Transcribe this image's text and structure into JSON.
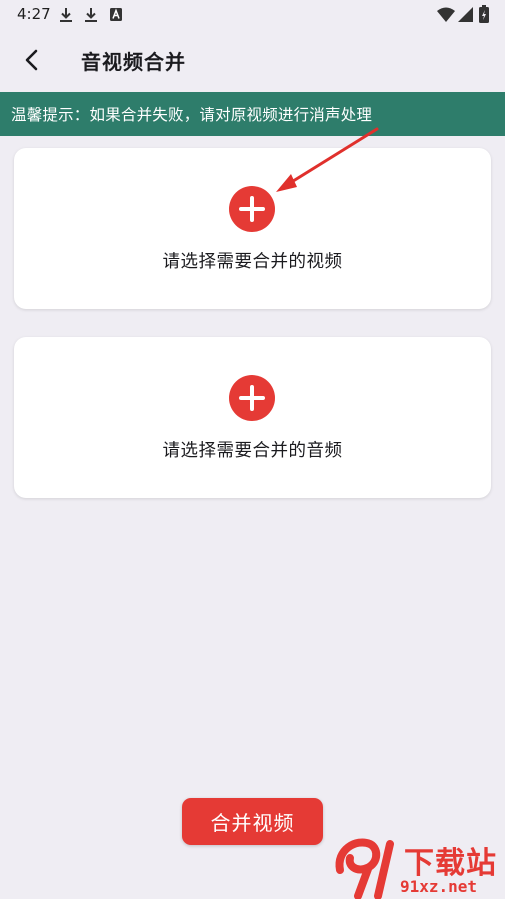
{
  "status_bar": {
    "time": "4:27",
    "left_icons": [
      "download-icon",
      "download-icon",
      "text-a-icon"
    ],
    "right_icons": [
      "wifi-icon",
      "signal-icon",
      "battery-charging-icon"
    ]
  },
  "header": {
    "back_icon": "chevron-left-icon",
    "title": "音视频合并"
  },
  "tip_banner": {
    "text": "温馨提示：如果合并失败，请对原视频进行消声处理"
  },
  "cards": [
    {
      "icon": "plus-circle-icon",
      "label": "请选择需要合并的视频"
    },
    {
      "icon": "plus-circle-icon",
      "label": "请选择需要合并的音频"
    }
  ],
  "footer": {
    "merge_label": "合并视频"
  },
  "watermark": {
    "text": "下载站",
    "domain": "91xz.net"
  },
  "colors": {
    "background": "#efedf3",
    "banner": "#2e7d6b",
    "accent_red": "#e53a35",
    "card": "#ffffff"
  }
}
